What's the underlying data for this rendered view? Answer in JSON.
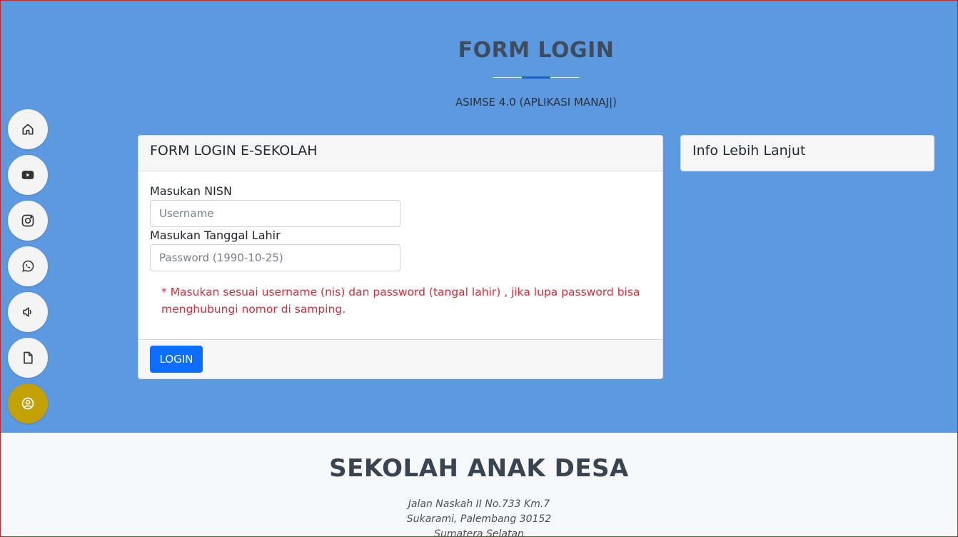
{
  "hero": {
    "title": "FORM LOGIN",
    "subtitle": "ASIMSE 4.0 (APLIKASI MANAJ|)",
    "accent_color": "#1a63c5",
    "background_color": "#5d99df"
  },
  "side_nav": {
    "items": [
      {
        "icon": "home-icon",
        "active": false
      },
      {
        "icon": "youtube-icon",
        "active": false
      },
      {
        "icon": "instagram-icon",
        "active": false
      },
      {
        "icon": "whatsapp-icon",
        "active": false
      },
      {
        "icon": "speaker-icon",
        "active": false
      },
      {
        "icon": "document-icon",
        "active": false
      },
      {
        "icon": "user-circle-icon",
        "active": true
      }
    ],
    "active_color": "#c3a006"
  },
  "login_card": {
    "title": "FORM LOGIN E-SEKOLAH",
    "nisn_label": "Masukan NISN",
    "nisn_placeholder": "Username",
    "nisn_value": "",
    "dob_label": "Masukan Tanggal Lahir",
    "dob_placeholder": "Password (1990-10-25)",
    "dob_value": "",
    "note": "* Masukan sesuai username (nis) dan password (tangal lahir) , jika lupa password bisa menghubungi nomor di samping.",
    "note_color": "#d22f3a",
    "login_button": "LOGIN",
    "button_color": "#0d6efd"
  },
  "info_card": {
    "title": "Info Lebih Lanjut"
  },
  "footer": {
    "title": "SEKOLAH ANAK DESA",
    "address_line1": "Jalan Naskah II No.733 Km.7",
    "address_line2": "Sukarami, Palembang 30152",
    "address_line3": "Sumatera Selatan"
  }
}
